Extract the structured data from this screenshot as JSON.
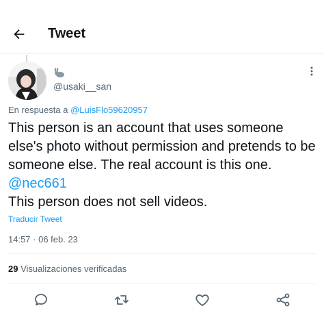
{
  "header": {
    "title": "Tweet"
  },
  "tweet": {
    "handle": "@usaki__san",
    "reply_prefix": "En respuesta a",
    "reply_to": "@LuisFlo59620957",
    "body_lines": [
      "This person is an account that uses someone else's photo without permission and pretends to be someone else. The real account is this one.",
      "This person does not sell videos."
    ],
    "body_mention": "@nec661",
    "translate": "Traducir Tweet",
    "timestamp": "14:57 · 06 feb. 23",
    "views_count": "29",
    "views_label": "Visualizaciones verificadas"
  },
  "colors": {
    "accent": "#1d9bf0",
    "secondary": "#536471",
    "divider": "#eff3f4"
  },
  "icons": {
    "back": "arrow-left-icon",
    "more": "more-icon",
    "reply": "reply-icon",
    "retweet": "retweet-icon",
    "like": "heart-icon",
    "share": "share-icon"
  }
}
